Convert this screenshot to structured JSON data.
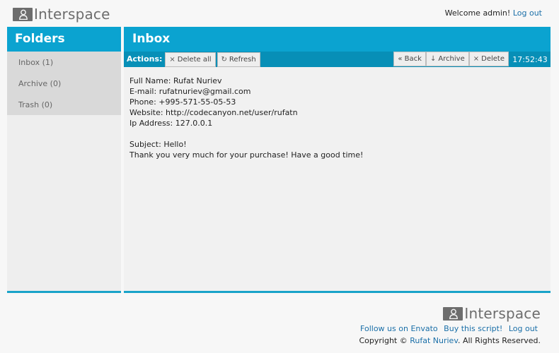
{
  "brand": {
    "name": "Interspace"
  },
  "header": {
    "welcome": "Welcome admin!",
    "logout": "Log out"
  },
  "sidebar": {
    "title": "Folders",
    "items": [
      {
        "label": "Inbox (1)"
      },
      {
        "label": "Archive (0)"
      },
      {
        "label": "Trash (0)"
      }
    ]
  },
  "main": {
    "title": "Inbox",
    "actions_label": "Actions:",
    "buttons": {
      "delete_all": "Delete all",
      "refresh": "Refresh",
      "back": "« Back",
      "archive": "Archive",
      "delete": "Delete"
    },
    "clock": "17:52:43"
  },
  "message": {
    "lines": [
      "Full Name: Rufat Nuriev",
      "E-mail: rufatnuriev@gmail.com",
      "Phone: +995-571-55-05-53",
      "Website: http://codecanyon.net/user/rufatn",
      "Ip Address: 127.0.0.1"
    ],
    "subject": "Subject: Hello!",
    "body": "Thank you very much for your purchase! Have a good time!"
  },
  "footer": {
    "links": [
      "Follow us on Envato",
      "Buy this script!",
      "Log out"
    ],
    "copyright_prefix": "Copyright ©",
    "copyright_name": "Rufat Nuriev",
    "copyright_suffix": ". All Rights Reserved."
  },
  "colors": {
    "accent": "#0ba3d0",
    "accent_dark": "#078fb7",
    "logo_gray": "#6d6d6d"
  }
}
